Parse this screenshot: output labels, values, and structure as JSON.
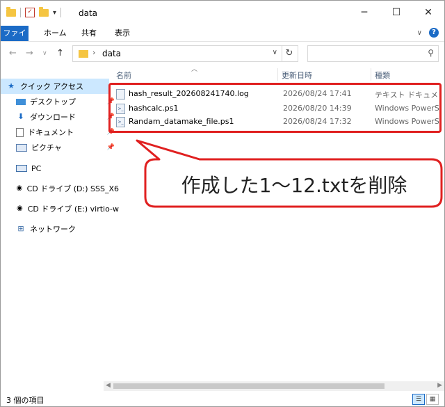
{
  "window": {
    "title": "data"
  },
  "ribbon": {
    "tabs": [
      "ファイル",
      "ホーム",
      "共有",
      "表示"
    ]
  },
  "address": {
    "path": "data",
    "search_placeholder": ""
  },
  "sidebar": {
    "items": [
      {
        "label": "クイック アクセス",
        "icon": "star-icon",
        "pinned": false
      },
      {
        "label": "デスクトップ",
        "icon": "desktop-icon",
        "pinned": true
      },
      {
        "label": "ダウンロード",
        "icon": "download-icon",
        "pinned": true
      },
      {
        "label": "ドキュメント",
        "icon": "document-icon",
        "pinned": true
      },
      {
        "label": "ピクチャ",
        "icon": "picture-icon",
        "pinned": true
      },
      {
        "label": "PC",
        "icon": "pc-icon",
        "pinned": false
      },
      {
        "label": "CD ドライブ (D:) SSS_X6",
        "icon": "cd-drive-icon",
        "pinned": false
      },
      {
        "label": "CD ドライブ (E:) virtio-w",
        "icon": "cd-drive-icon",
        "pinned": false
      },
      {
        "label": "ネットワーク",
        "icon": "network-icon",
        "pinned": false
      }
    ]
  },
  "columns": {
    "name": "名前",
    "modified": "更新日時",
    "type": "種類"
  },
  "files": [
    {
      "name": "hash_result_202608241740.log",
      "modified": "2026/08/24 17:41",
      "type": "テキスト ドキュメント",
      "icon": "text-file-icon"
    },
    {
      "name": "hashcalc.ps1",
      "modified": "2026/08/20 14:39",
      "type": "Windows PowerS...",
      "icon": "powershell-file-icon"
    },
    {
      "name": "Randam_datamake_file.ps1",
      "modified": "2026/08/24 17:32",
      "type": "Windows PowerS...",
      "icon": "powershell-file-icon"
    }
  ],
  "callout": {
    "text": "作成した1～12.txtを削除"
  },
  "status": {
    "item_count": "3 個の項目"
  },
  "colors": {
    "accent": "#1b6bc6",
    "highlight": "#e02020"
  }
}
